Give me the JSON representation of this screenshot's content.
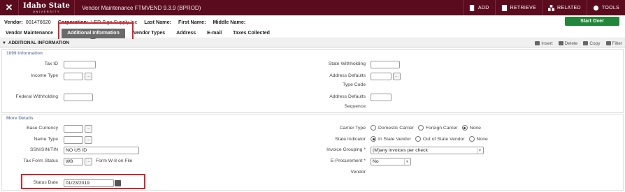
{
  "topbar": {
    "logo_line1": "Idaho State",
    "logo_line2": "UNIVERSITY",
    "title": "Vendor Maintenance FTMVEND 9.3.9 (BPROD)",
    "actions": [
      {
        "label": "ADD",
        "icon": "add-document-icon"
      },
      {
        "label": "RETRIEVE",
        "icon": "retrieve-icon"
      },
      {
        "label": "RELATED",
        "icon": "related-icon"
      },
      {
        "label": "TOOLS",
        "icon": "gear-icon"
      }
    ]
  },
  "context": {
    "vendor_label": "Vendor:",
    "vendor_value": "001476620",
    "corporation_label": "Corporation:",
    "corporation_value": "LED Sign Supply Inc",
    "last_name_label": "Last Name:",
    "first_name_label": "First Name:",
    "middle_name_label": "Middle Name:",
    "start_over": "Start Over"
  },
  "tabs": [
    {
      "label": "Vendor Maintenance"
    },
    {
      "label": "Additional Information"
    },
    {
      "label": "Vendor Types"
    },
    {
      "label": "Address"
    },
    {
      "label": "E-mail"
    },
    {
      "label": "Taxes Collected"
    }
  ],
  "section": {
    "title": "ADDITIONAL INFORMATION",
    "tools": {
      "insert": "Insert",
      "delete": "Delete",
      "copy": "Copy",
      "filter": "Filter"
    }
  },
  "panel_1099": {
    "title": "1099 Information",
    "tax_id_label": "Tax ID",
    "tax_id_value": "",
    "income_type_label": "Income Type",
    "federal_withholding_label": "Federal Withholding",
    "state_withholding_label": "State Withholding",
    "address_defaults_type_label_1": "Address Defaults",
    "address_defaults_type_label_2": "Type Code",
    "address_defaults_seq_label_1": "Address Defaults",
    "address_defaults_seq_label_2": "Sequence"
  },
  "panel_more": {
    "title": "More Details",
    "base_currency_label": "Base Currency",
    "name_type_label": "Name Type",
    "ssn_label": "SSN/SIN/TIN",
    "ssn_value": "NO US ID",
    "tax_form_status_label": "Tax Form Status",
    "tax_form_status_value": "W8",
    "tax_form_status_desc": "Form W-8 on File",
    "status_date_label": "Status Date",
    "status_date_value": "01/23/2019",
    "carrier_type_label": "Carrier Type",
    "carrier_options": [
      "Domestic Carrier",
      "Foreign Carrier",
      "None"
    ],
    "state_indicator_label": "State Indicator",
    "state_options": [
      "In State Vendor",
      "Out of State Vendor",
      "None"
    ],
    "invoice_grouping_label": "Invoice Grouping *",
    "invoice_grouping_value": "(M)any invoices per check",
    "eprocurement_label_1": "E-Procurement *",
    "eprocurement_label_2": "Vendor",
    "eprocurement_value": "No"
  }
}
